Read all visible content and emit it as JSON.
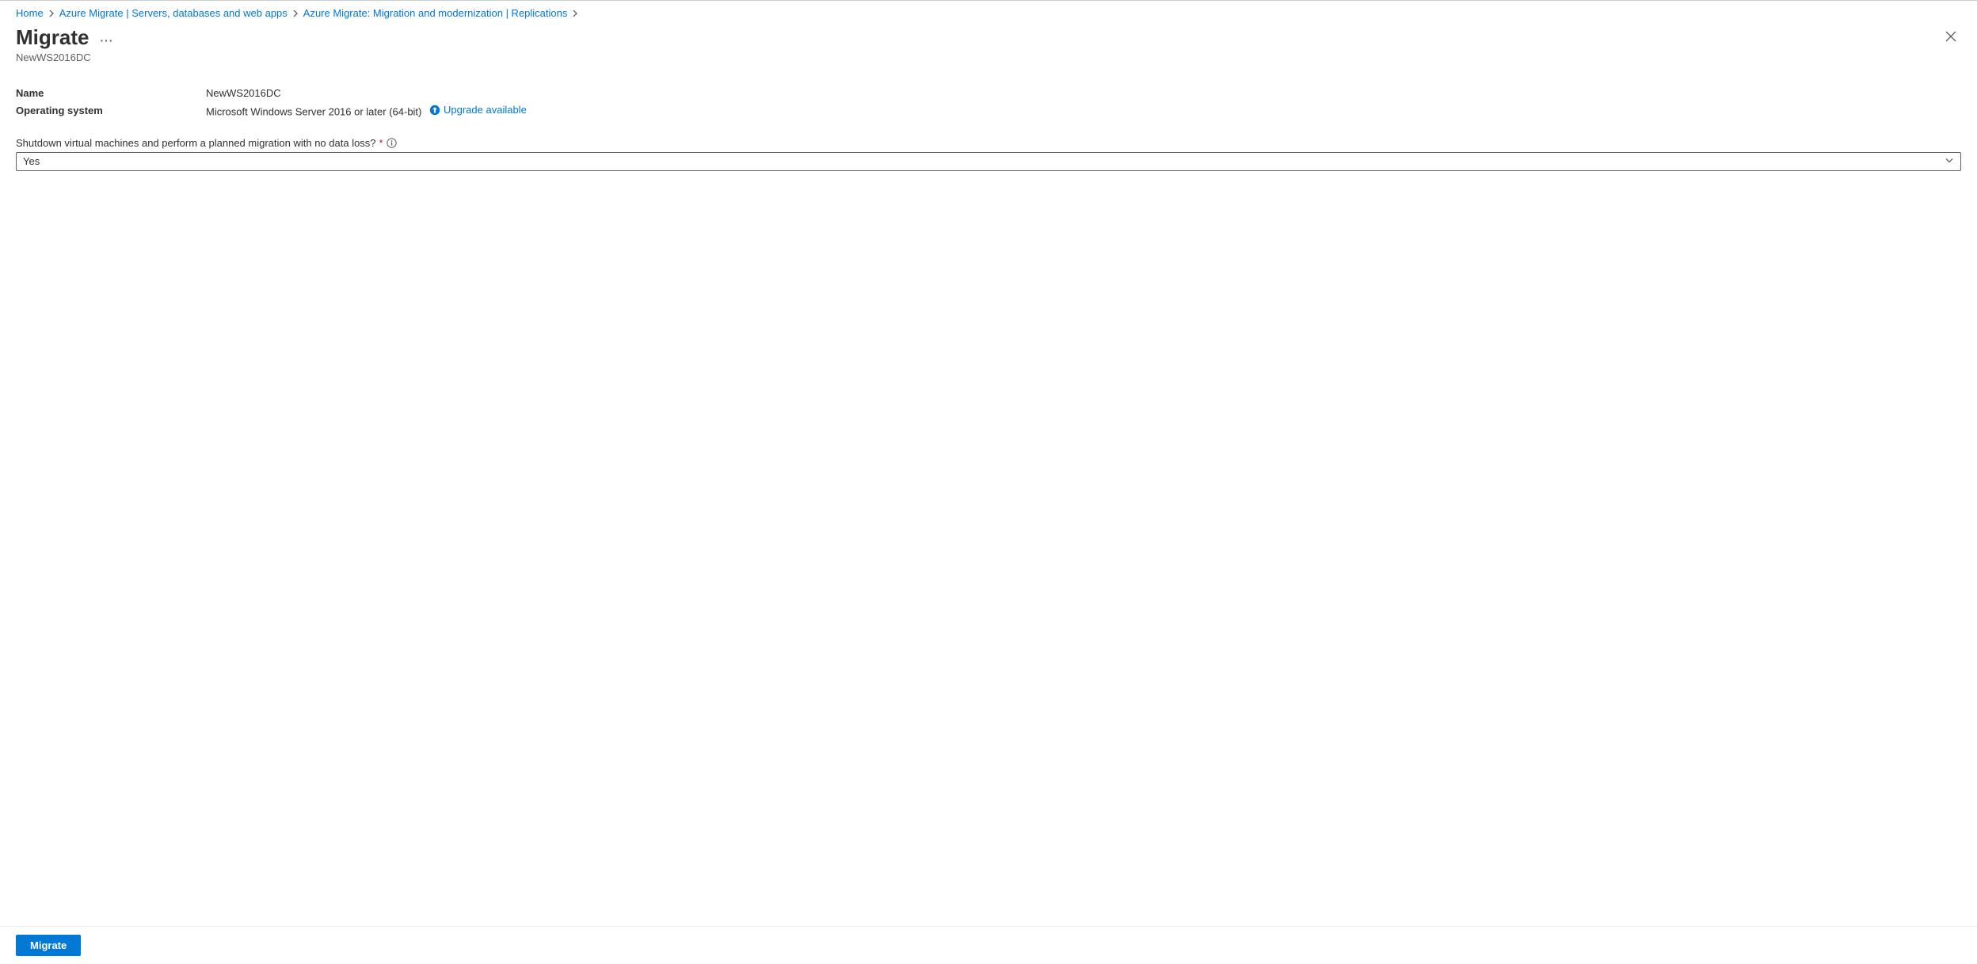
{
  "breadcrumb": {
    "items": [
      {
        "label": "Home"
      },
      {
        "label": "Azure Migrate | Servers, databases and web apps"
      },
      {
        "label": "Azure Migrate: Migration and modernization | Replications"
      }
    ]
  },
  "header": {
    "title": "Migrate",
    "subtitle": "NewWS2016DC"
  },
  "fields": {
    "name_label": "Name",
    "name_value": "NewWS2016DC",
    "os_label": "Operating system",
    "os_value": "Microsoft Windows Server 2016 or later (64-bit)",
    "upgrade_link": "Upgrade available"
  },
  "form": {
    "shutdown_label": "Shutdown virtual machines and perform a planned migration with no data loss?",
    "shutdown_value": "Yes"
  },
  "footer": {
    "migrate_button": "Migrate"
  }
}
